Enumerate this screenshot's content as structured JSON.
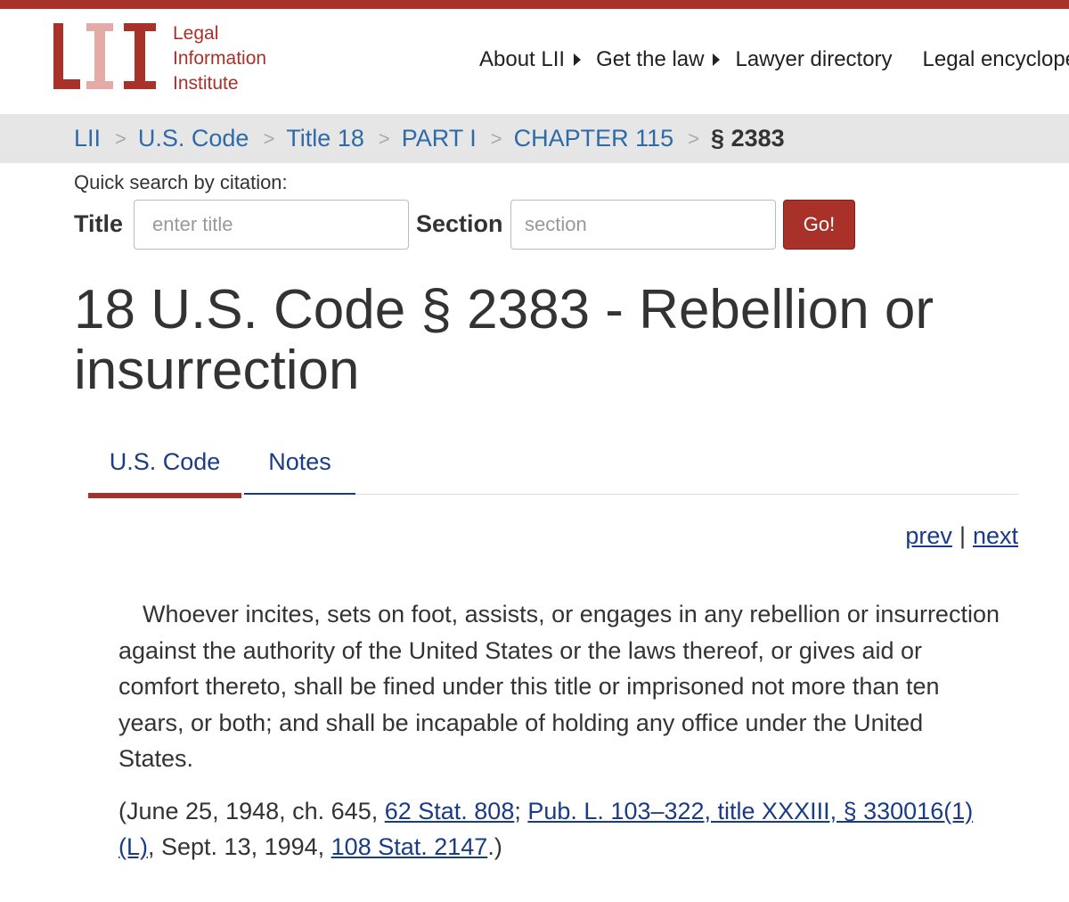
{
  "logo": {
    "mark": "LII",
    "line1": "Legal",
    "line2": "Information",
    "line3": "Institute"
  },
  "nav": {
    "items": [
      {
        "label": "About LII"
      },
      {
        "label": "Get the law"
      },
      {
        "label": "Lawyer directory"
      },
      {
        "label": "Legal encyclope"
      }
    ]
  },
  "breadcrumb": {
    "separator": ">",
    "items": [
      "LII",
      "U.S. Code",
      "Title 18",
      "PART I",
      "CHAPTER 115"
    ],
    "current": "§ 2383"
  },
  "quick_search": {
    "label": "Quick search by citation:",
    "title_label": "Title",
    "title_placeholder": "enter title",
    "section_label": "Section",
    "section_placeholder": "section",
    "go_label": "Go!"
  },
  "page": {
    "title": "18 U.S. Code § 2383 - Rebellion or insurrection"
  },
  "tabs": [
    {
      "label": "U.S. Code",
      "active": true
    },
    {
      "label": "Notes",
      "active": false
    }
  ],
  "pager": {
    "prev": "prev",
    "separator": "|",
    "next": "next"
  },
  "statute": {
    "text": "Whoever incites, sets on foot, assists, or engages in any rebellion or insurrection against the authority of the United States or the laws thereof, or gives aid or comfort thereto, shall be fined under this title or imprisoned not more than ten years, or both; and shall be incapable of holding any office under the United States."
  },
  "credits": {
    "open": "(June 25, 1948, ch. 645, ",
    "link1": "62 Stat. 808",
    "sep1": "; ",
    "link2": "Pub. L. 103–322, title XXXIII, § 330016(1)(L)",
    "mid": ", Sept. 13, 1994, ",
    "link3": "108 Stat. 2147",
    "close": ".)"
  },
  "colors": {
    "brand_red": "#a8312a",
    "link_blue": "#1a3c86",
    "crumb_blue": "#2e6aa8",
    "crumb_bg": "#e6e6e6"
  }
}
